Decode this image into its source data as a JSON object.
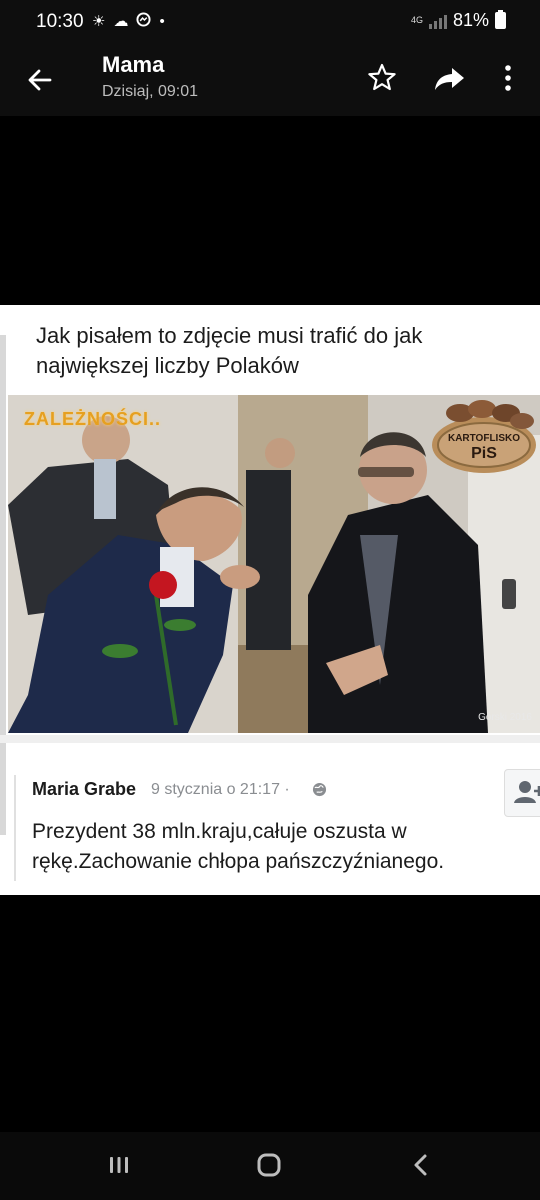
{
  "status_bar": {
    "time": "10:30",
    "icons": [
      "sun-icon",
      "cloud-icon",
      "messenger-icon",
      "dot-icon"
    ],
    "network": "4G",
    "battery": "81%"
  },
  "app_bar": {
    "title": "Mama",
    "subtitle": "Dzisiaj, 09:01",
    "actions": [
      "back-arrow-icon",
      "star-icon",
      "share-icon",
      "more-vert-icon"
    ]
  },
  "shared_post": {
    "caption": "Jak pisałem to zdjęcie musi trafić do jak największej liczby Polaków",
    "photo": {
      "overlay_text": "ZALEŻNOŚCI..",
      "badge_label": "KARTOFLISKO",
      "badge_party": "PiS",
      "credit": "Górski 2016"
    },
    "comment": {
      "author": "Maria Grabe",
      "meta": "9 stycznia o 21:17 ·",
      "text": "Prezydent 38 mln.kraju,całuje oszusta w rękę.Zachowanie chłopa pańszczyźnianego."
    }
  },
  "nav_bar": {
    "buttons": [
      "recents-icon",
      "home-icon",
      "back-icon"
    ]
  }
}
